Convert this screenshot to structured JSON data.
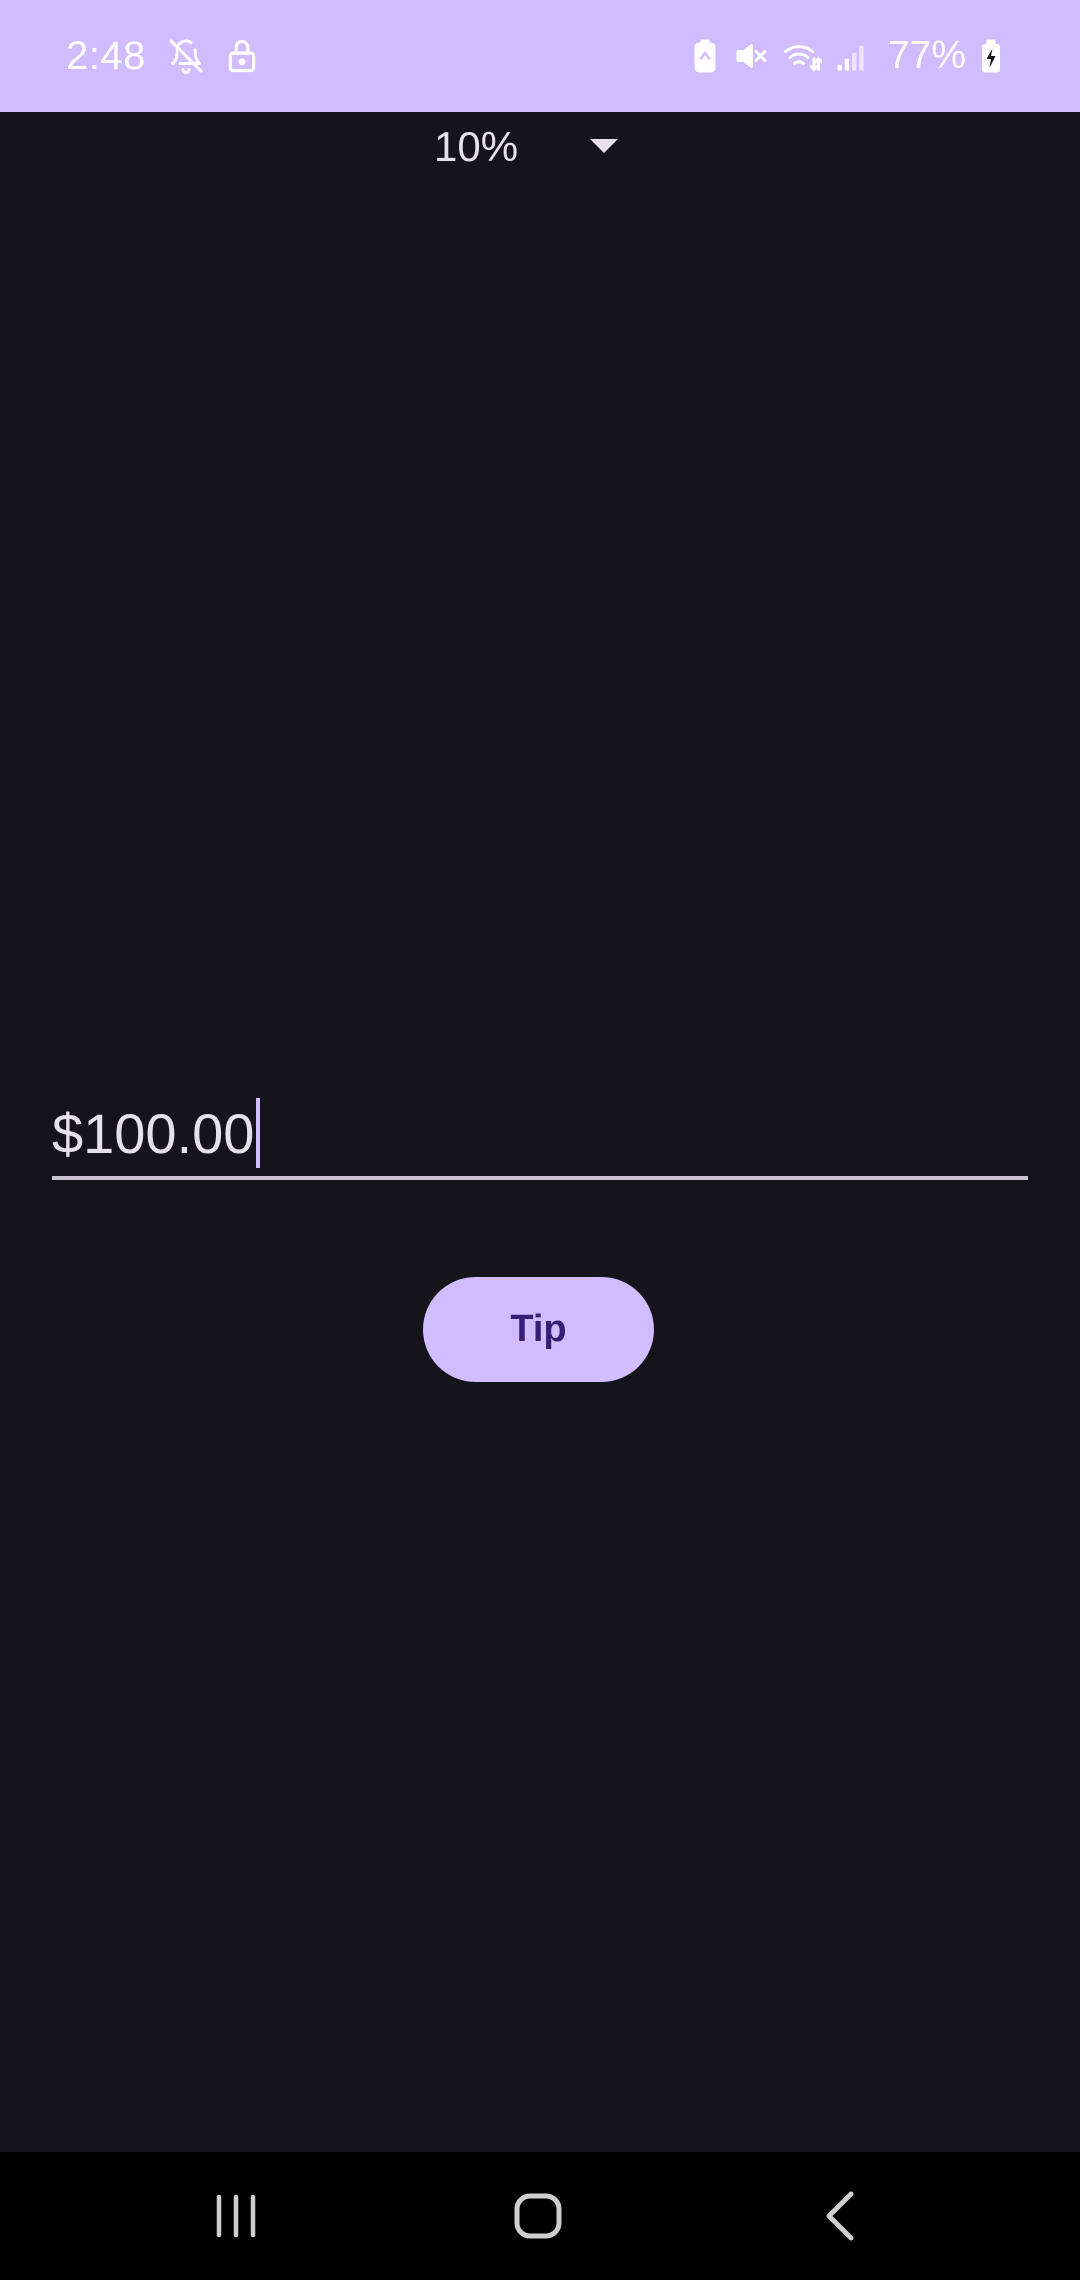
{
  "status_bar": {
    "time": "2:48",
    "battery": "77%",
    "background_color": "#d0bcfe",
    "icons_left": [
      "notifications-off-icon",
      "lock-icon"
    ],
    "icons_right": [
      "battery-saver-icon",
      "mute-icon",
      "wifi-icon",
      "signal-icon",
      "battery-charging-icon"
    ]
  },
  "tip_selector": {
    "selected": "10%",
    "icon": "dropdown-arrow-icon"
  },
  "amount_input": {
    "value": "$100.00"
  },
  "tip_button": {
    "label": "Tip",
    "color": "#d0bcfe",
    "text_color": "#381e72"
  },
  "nav_bar": {
    "icons": [
      "recent-apps-icon",
      "home-icon",
      "back-icon"
    ]
  },
  "theme": {
    "background": "#16141b",
    "accent": "#d0bcfe"
  }
}
